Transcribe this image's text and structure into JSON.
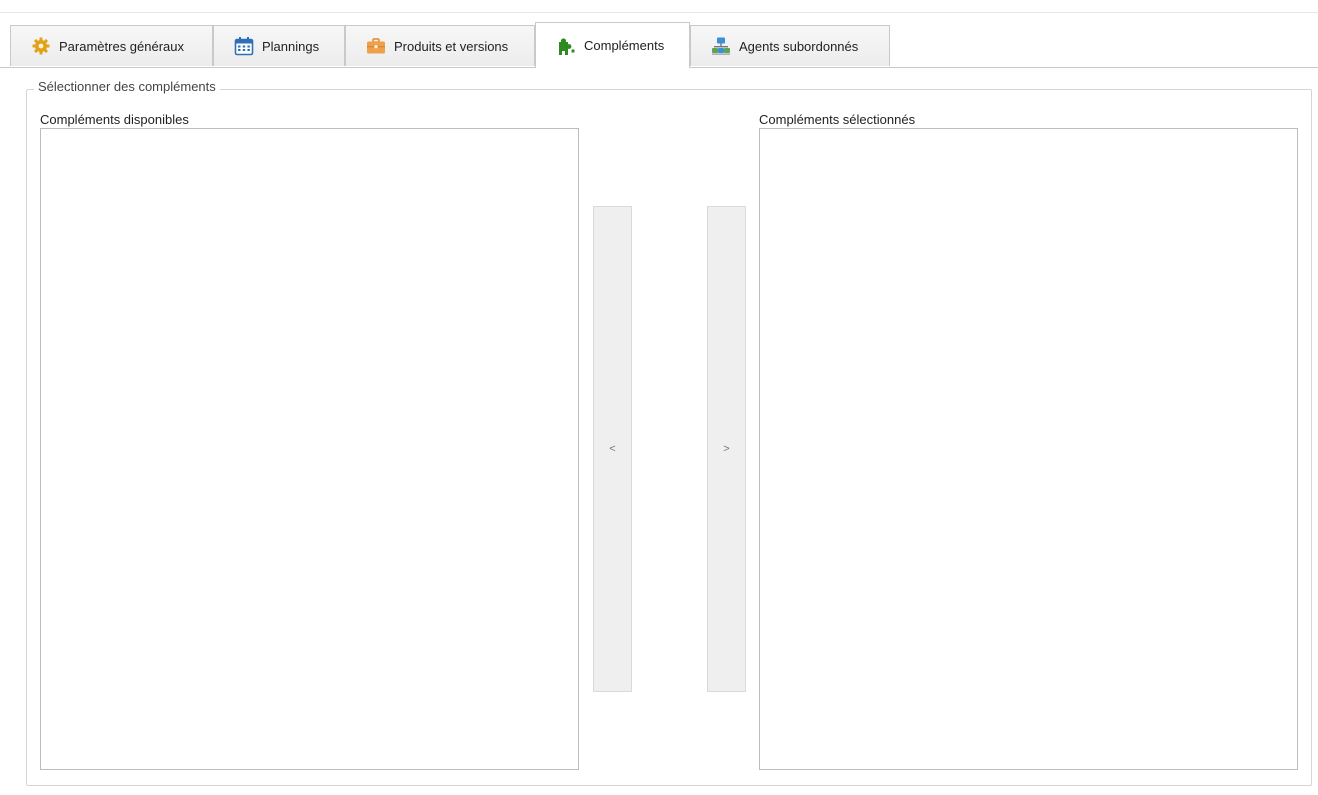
{
  "tabs": [
    {
      "label": "Paramètres généraux",
      "icon": "gear-icon",
      "active": false
    },
    {
      "label": "Plannings",
      "icon": "calendar-icon",
      "active": false
    },
    {
      "label": "Produits et versions",
      "icon": "briefcase-icon",
      "active": false
    },
    {
      "label": "Compléments",
      "icon": "puzzle-icon",
      "active": true
    },
    {
      "label": "Agents subordonnés",
      "icon": "network-icon",
      "active": false
    }
  ],
  "group": {
    "legend": "Sélectionner des compléments",
    "available_label": "Compléments disponibles",
    "selected_label": "Compléments sélectionnés",
    "move_left_label": "<",
    "move_right_label": ">"
  },
  "colors": {
    "gear": "#e0a21a",
    "calendar": "#2f6fb8",
    "briefcase": "#f0a04b",
    "puzzle": "#2e8b1f",
    "network": "#3a8fd6"
  }
}
